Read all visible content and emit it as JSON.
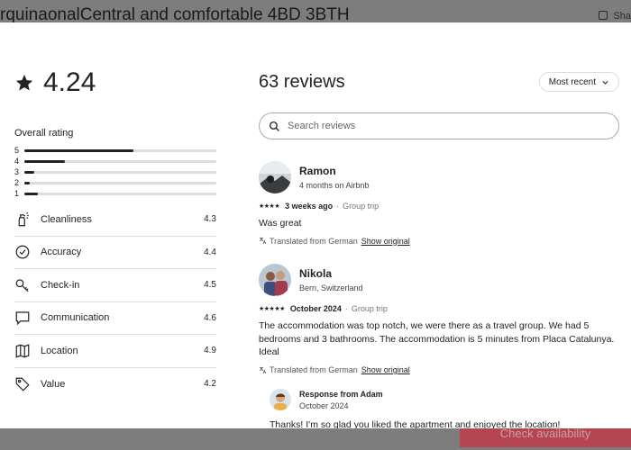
{
  "background": {
    "listing_title": "rquinaonalCentral and comfortable 4BD 3BTH",
    "share_label": "Sha",
    "check_availability": "Check availability"
  },
  "summary": {
    "rating": "4.24",
    "overall_label": "Overall rating",
    "distribution": [
      {
        "label": "5",
        "fraction": 0.57
      },
      {
        "label": "4",
        "fraction": 0.21
      },
      {
        "label": "3",
        "fraction": 0.05
      },
      {
        "label": "2",
        "fraction": 0.03
      },
      {
        "label": "1",
        "fraction": 0.07
      }
    ],
    "categories": [
      {
        "name": "Cleanliness",
        "score": "4.3",
        "icon": "spray-bottle-icon"
      },
      {
        "name": "Accuracy",
        "score": "4.4",
        "icon": "check-circle-icon"
      },
      {
        "name": "Check-in",
        "score": "4.5",
        "icon": "key-icon"
      },
      {
        "name": "Communication",
        "score": "4.6",
        "icon": "chat-bubble-icon"
      },
      {
        "name": "Location",
        "score": "4.9",
        "icon": "map-icon"
      },
      {
        "name": "Value",
        "score": "4.2",
        "icon": "tag-icon"
      }
    ]
  },
  "reviews": {
    "count_label": "63 reviews",
    "sort_label": "Most recent",
    "search_placeholder": "Search reviews",
    "items": [
      {
        "name": "Ramon",
        "sub": "4 months on Airbnb",
        "stars": "★★★★",
        "date": "3 weeks ago",
        "trip": "Group trip",
        "text": "Was great",
        "translated": "Translated from German",
        "show_original": "Show original"
      },
      {
        "name": "Nikola",
        "sub": "Bern, Switzerland",
        "stars": "★★★★★",
        "date": "October 2024",
        "trip": "Group trip",
        "text": "The accommodation was top notch, we were there as a travel group. We had 5 bedrooms and 3 bathrooms. The accommodation is 5 minutes from Placa Catalunya. Ideal",
        "translated": "Translated from German",
        "show_original": "Show original",
        "response": {
          "title": "Response from Adam",
          "date": "October 2024",
          "text": "Thanks! I'm so glad you liked the apartment and enjoyed the location!"
        }
      }
    ]
  },
  "colors": {
    "accent": "#b54550",
    "text": "#222222",
    "divider": "#dddddd"
  }
}
